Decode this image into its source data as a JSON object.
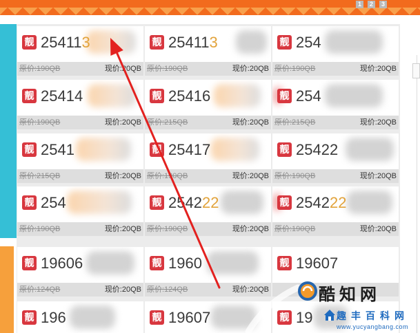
{
  "pager": {
    "pages": [
      "1",
      "2",
      "3"
    ]
  },
  "badge_label": "靓",
  "listings": [
    {
      "digits": "25411",
      "highlight": "3",
      "original_price": "原价:190QB",
      "current_price": "现价:20QB"
    },
    {
      "digits": "25411",
      "highlight": "3",
      "original_price": "原价:190QB",
      "current_price": "现价:20QB"
    },
    {
      "digits": "254",
      "original_price": "原价:190QB",
      "current_price": "现价:20QB"
    },
    {
      "digits": "25414",
      "original_price": "原价:190QB",
      "current_price": "现价:20QB"
    },
    {
      "digits": "25416",
      "original_price": "原价:215QB",
      "current_price": "现价:20QB"
    },
    {
      "digits": "254",
      "original_price": "原价:215QB",
      "current_price": "现价:20QB"
    },
    {
      "digits": "2541",
      "original_price": "原价:215QB",
      "current_price": "现价:20QB"
    },
    {
      "digits": "25417",
      "original_price": "原价:190QB",
      "current_price": "现价:20QB"
    },
    {
      "digits": "25422",
      "original_price": "原价:190QB",
      "current_price": "现价:20QB"
    },
    {
      "digits": "254",
      "original_price": "原价:190QB",
      "current_price": "现价:20QB"
    },
    {
      "digits": "2542",
      "highlight": "22",
      "original_price": "原价:190QB",
      "current_price": "现价:20QB"
    },
    {
      "digits": "2542",
      "highlight": "22",
      "original_price": "原价:190QB",
      "current_price": "现价:20QB"
    },
    {
      "digits": "19606",
      "original_price": "原价:124QB",
      "current_price": "现价:20QB"
    },
    {
      "digits": "1960",
      "original_price": "原价:124QB",
      "current_price": "现价:20QB"
    },
    {
      "digits": "19607"
    },
    {
      "digits": "196"
    },
    {
      "digits": "19607"
    },
    {
      "digits": "19"
    }
  ],
  "watermark": {
    "brand": "酷知网",
    "site_name": "趣丰百科网",
    "site_url": "www.yucyangbang.com"
  },
  "icons": {
    "annotation": "red-arrow-icon",
    "brand_logo": "kuzhi-logo-icon",
    "site_logo": "house-logo-icon"
  },
  "colors": {
    "top_bar_orange": "#f26b1d",
    "side_cyan": "#35bfd6",
    "side_orange": "#f6a03c",
    "badge_red": "#d8373f",
    "highlight_digits": "#e2a33b",
    "arrow_red": "#e3211f",
    "watermark_blue": "#1f6bbf"
  }
}
